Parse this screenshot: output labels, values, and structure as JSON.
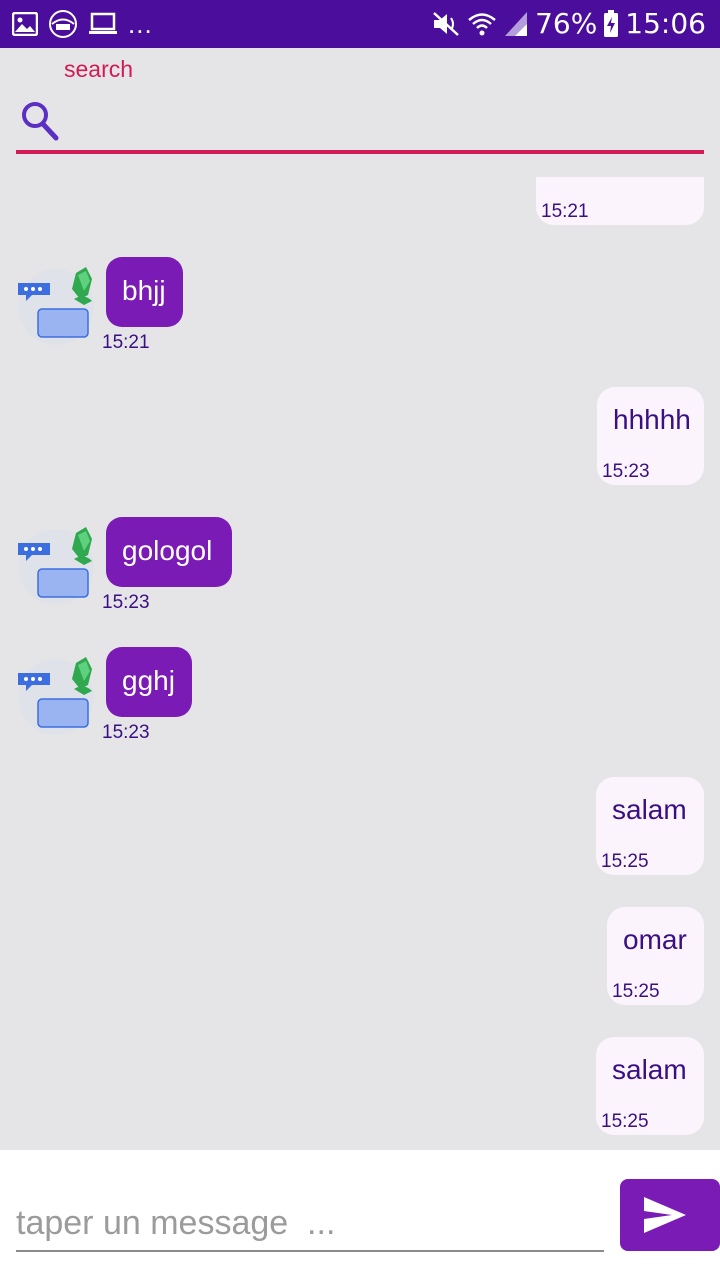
{
  "status_bar": {
    "overflow_dots": "...",
    "battery_percent": "76%",
    "clock": "15:06",
    "icons": [
      "image-icon",
      "app-logo-icon",
      "laptop-icon",
      "mute-icon",
      "wifi-icon",
      "signal-icon",
      "battery-icon"
    ]
  },
  "search": {
    "label": "search",
    "value": "",
    "icon": "search-icon"
  },
  "messages": [
    {
      "dir": "out",
      "text": "",
      "time": "15:21"
    },
    {
      "dir": "in",
      "text": "bhjj",
      "time": "15:21"
    },
    {
      "dir": "out",
      "text": "hhhhh",
      "time": "15:23"
    },
    {
      "dir": "in",
      "text": "gologol",
      "time": "15:23"
    },
    {
      "dir": "in",
      "text": "gghj",
      "time": "15:23"
    },
    {
      "dir": "out",
      "text": "salam",
      "time": "15:25"
    },
    {
      "dir": "out",
      "text": "omar",
      "time": "15:25"
    },
    {
      "dir": "out",
      "text": "salam",
      "time": "15:25"
    }
  ],
  "composer": {
    "placeholder": "taper un message  ...",
    "send_icon": "send-icon"
  },
  "colors": {
    "status_bar": "#4a0d9c",
    "accent": "#d11b55",
    "incoming_bubble": "#7b1bb6",
    "outgoing_bubble": "#fcf4fc",
    "text_purple": "#3a0f83"
  }
}
